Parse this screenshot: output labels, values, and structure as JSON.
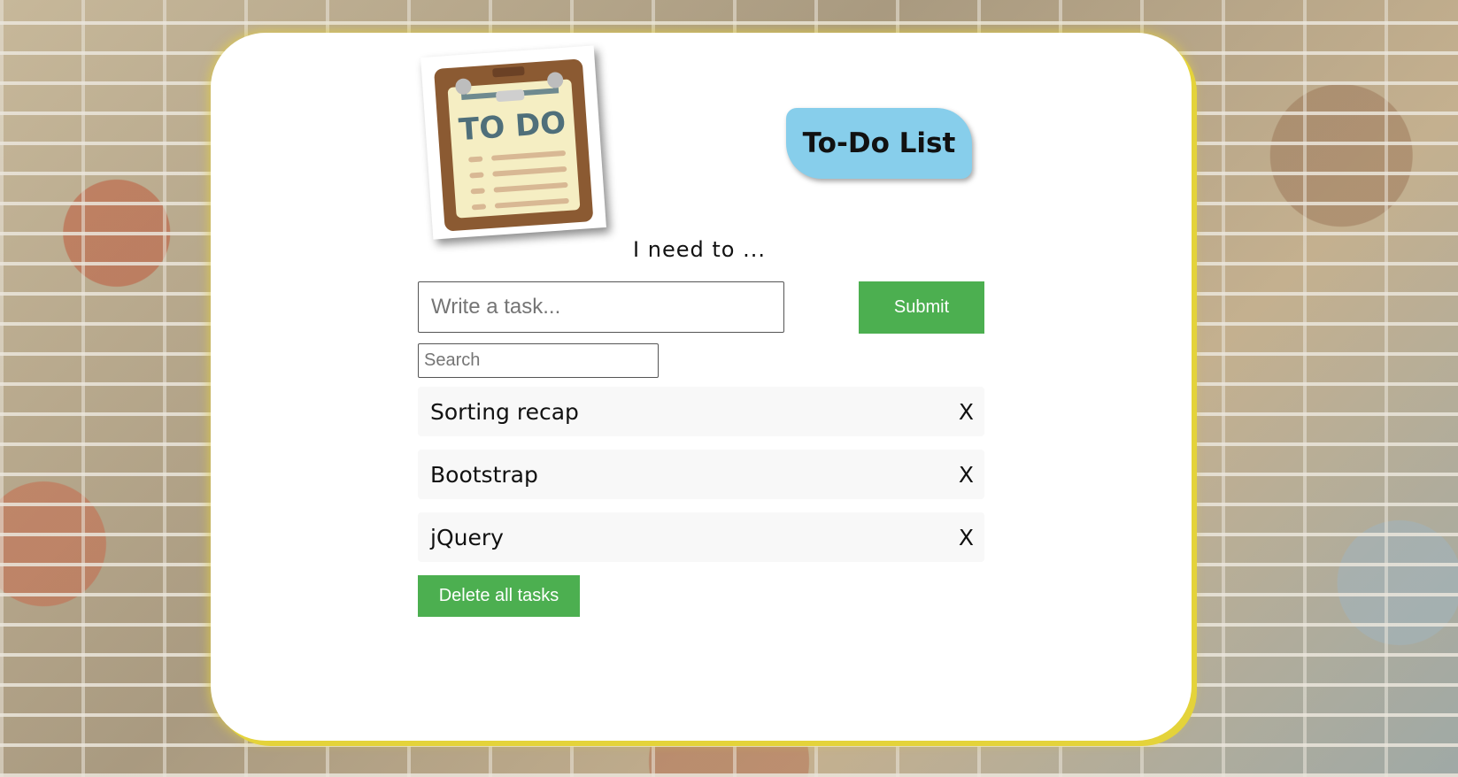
{
  "header": {
    "logo_text": "TO DO",
    "title": "To-Do List"
  },
  "form": {
    "prompt": "I need to ...",
    "task_placeholder": "Write a task...",
    "submit_label": "Submit",
    "search_placeholder": "Search"
  },
  "tasks": [
    {
      "label": "Sorting recap",
      "delete_label": "X"
    },
    {
      "label": "Bootstrap",
      "delete_label": "X"
    },
    {
      "label": "jQuery",
      "delete_label": "X"
    }
  ],
  "actions": {
    "delete_all_label": "Delete all tasks"
  },
  "colors": {
    "accent": "#4caf50",
    "title_badge": "#87ceeb",
    "card_glow": "#e4d33a"
  }
}
